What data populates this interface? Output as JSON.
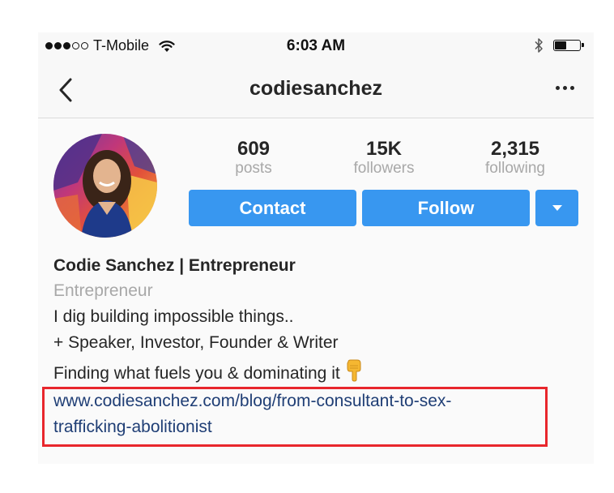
{
  "status_bar": {
    "carrier": "T-Mobile",
    "time": "6:03 AM",
    "signal_bars_filled": 3,
    "signal_bars_total": 5,
    "battery_level": 0.45
  },
  "nav": {
    "title": "codiesanchez"
  },
  "profile": {
    "stats": [
      {
        "value": "609",
        "label": "posts"
      },
      {
        "value": "15K",
        "label": "followers"
      },
      {
        "value": "2,315",
        "label": "following"
      }
    ],
    "buttons": {
      "contact": "Contact",
      "follow": "Follow"
    },
    "bio": {
      "name": "Codie Sanchez | Entrepreneur",
      "category": "Entrepreneur",
      "line1": "I dig building impossible things..",
      "line2": "+ Speaker, Investor, Founder & Writer",
      "line3": "Finding what fuels you & dominating it",
      "link_part1": "www.codiesanchez.com/blog/from-consultant-to-sex-",
      "link_part2": "trafficking-abolitionist"
    }
  },
  "colors": {
    "accent_blue": "#3897f0",
    "link": "#1f3e75",
    "highlight": "#e8262c",
    "muted": "#a8a8a8"
  },
  "icons": [
    "back-chevron-icon",
    "more-dots-icon",
    "wifi-icon",
    "bluetooth-icon",
    "battery-icon",
    "caret-down-icon",
    "pointing-down-emoji"
  ]
}
